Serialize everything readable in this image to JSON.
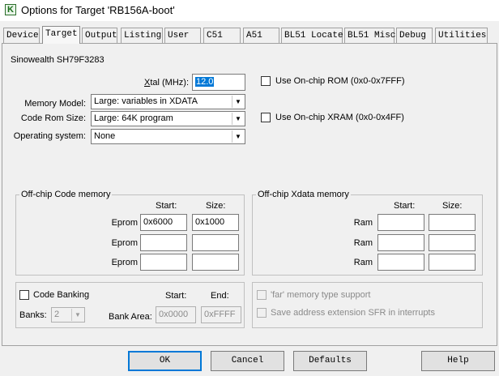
{
  "window": {
    "title": "Options for Target 'RB156A-boot'",
    "app_icon": "keil-icon"
  },
  "tabs": [
    "Device",
    "Target",
    "Output",
    "Listing",
    "User",
    "C51",
    "A51",
    "BL51 Locate",
    "BL51 Misc",
    "Debug",
    "Utilities"
  ],
  "active_tab": "Target",
  "device_name": "Sinowealth SH79F3283",
  "xtal": {
    "label_u": "X",
    "label_rest": "tal (MHz):",
    "value": "12.0"
  },
  "memory_model": {
    "label": "Memory Model:",
    "value": "Large: variables in XDATA"
  },
  "code_rom_size": {
    "label": "Code Rom Size:",
    "value": "Large: 64K program"
  },
  "operating_system": {
    "label": "Operating system:",
    "value": "None"
  },
  "onchip_rom": {
    "label": "Use On-chip ROM (0x0-0x7FFF)",
    "checked": false
  },
  "onchip_xram": {
    "label": "Use On-chip XRAM (0x0-0x4FF)",
    "checked": false
  },
  "code_memory": {
    "title": "Off-chip Code memory",
    "start_header": "Start:",
    "size_header": "Size:",
    "rows": [
      {
        "label": "Eprom",
        "start": "0x6000",
        "size": "0x1000"
      },
      {
        "label": "Eprom",
        "start": "",
        "size": ""
      },
      {
        "label": "Eprom",
        "start": "",
        "size": ""
      }
    ]
  },
  "xdata_memory": {
    "title": "Off-chip Xdata memory",
    "start_header": "Start:",
    "size_header": "Size:",
    "rows": [
      {
        "label": "Ram",
        "start": "",
        "size": ""
      },
      {
        "label": "Ram",
        "start": "",
        "size": ""
      },
      {
        "label": "Ram",
        "start": "",
        "size": ""
      }
    ]
  },
  "code_banking": {
    "label": "Code Banking",
    "checked": false,
    "banks_label": "Banks:",
    "banks_value": "2",
    "start_header": "Start:",
    "end_header": "End:",
    "bank_area_label": "Bank Area:",
    "bank_area_start": "0x0000",
    "bank_area_end": "0xFFFF"
  },
  "far_memory": {
    "label": "'far' memory type support",
    "checked": false
  },
  "save_sfr": {
    "label": "Save address extension SFR in interrupts",
    "checked": false
  },
  "buttons": {
    "ok": "OK",
    "cancel": "Cancel",
    "defaults": "Defaults",
    "help": "Help"
  }
}
